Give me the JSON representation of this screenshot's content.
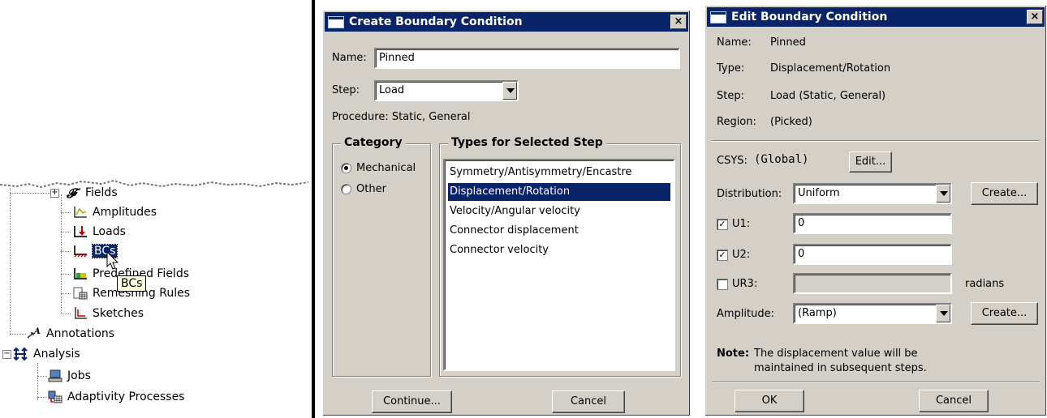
{
  "tree": {
    "items": [
      {
        "label": "Fields",
        "icon": "fields-icon"
      },
      {
        "label": "Amplitudes",
        "icon": "amplitudes-icon"
      },
      {
        "label": "Loads",
        "icon": "loads-icon"
      },
      {
        "label": "BCs",
        "icon": "bcs-icon"
      },
      {
        "label": "Predefined Fields",
        "icon": "predefined-fields-icon"
      },
      {
        "label": "Remeshing Rules",
        "icon": "remeshing-rules-icon"
      },
      {
        "label": "Sketches",
        "icon": "sketches-icon"
      },
      {
        "label": "Annotations",
        "icon": "annotations-icon"
      },
      {
        "label": "Analysis",
        "icon": "analysis-icon"
      },
      {
        "label": "Jobs",
        "icon": "jobs-icon"
      },
      {
        "label": "Adaptivity Processes",
        "icon": "adaptivity-processes-icon"
      }
    ],
    "tooltip": "BCs"
  },
  "create_dialog": {
    "title": "Create Boundary Condition",
    "close": "×",
    "name_label": "Name:",
    "name_value": "Pinned",
    "step_label": "Step:",
    "step_value": "Load",
    "procedure": "Procedure:  Static, General",
    "category_title": "Category",
    "categories": [
      "Mechanical",
      "Other"
    ],
    "types_title": "Types for Selected Step",
    "types": [
      "Symmetry/Antisymmetry/Encastre",
      "Displacement/Rotation",
      "Velocity/Angular velocity",
      "Connector displacement",
      "Connector velocity"
    ],
    "continue_label": "Continue...",
    "cancel_label": "Cancel"
  },
  "edit_dialog": {
    "title": "Edit Boundary Condition",
    "close": "×",
    "name_label": "Name:",
    "name_value": "Pinned",
    "type_label": "Type:",
    "type_value": "Displacement/Rotation",
    "step_label": "Step:",
    "step_value": "Load (Static, General)",
    "region_label": "Region:",
    "region_value": "(Picked)",
    "csys_label": "CSYS:",
    "csys_value": "(Global)",
    "csys_edit": "Edit...",
    "distribution_label": "Distribution:",
    "distribution_value": "Uniform",
    "create_label": "Create...",
    "u1_label": "U1:",
    "u1_value": "0",
    "u2_label": "U2:",
    "u2_value": "0",
    "ur3_label": "UR3:",
    "ur3_value": "",
    "radians": "radians",
    "amplitude_label": "Amplitude:",
    "amplitude_value": "(Ramp)",
    "create2_label": "Create...",
    "note_label": "Note:",
    "note_line1": "The displacement value will be",
    "note_line2": "maintained in subsequent steps.",
    "ok_label": "OK",
    "cancel_label": "Cancel"
  }
}
